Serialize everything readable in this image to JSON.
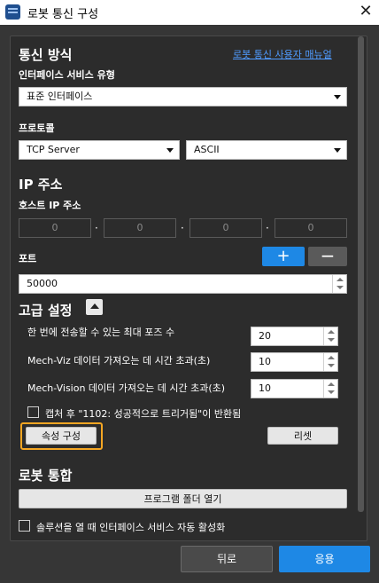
{
  "window": {
    "title": "로봇 통신 구성",
    "close_glyph": "✕"
  },
  "communication": {
    "heading": "통신 방식",
    "manual_link": "로봇 통신 사용자 매뉴얼",
    "interface_type_label": "인터페이스 서비스 유형",
    "interface_type_value": "표준 인터페이스",
    "protocol_label": "프로토콜",
    "protocol_transport": "TCP Server",
    "protocol_format": "ASCII"
  },
  "ip": {
    "heading": "IP 주소",
    "host_label": "호스트 IP 주소",
    "octets": [
      "0",
      "0",
      "0",
      "0"
    ],
    "port_label": "포트",
    "port_value": "50000",
    "add_glyph": "+",
    "remove_glyph": "−"
  },
  "advanced": {
    "heading": "고급 설정",
    "max_poses_label": "한 번에 전송할 수 있는 최대 포즈 수",
    "max_poses_value": "20",
    "viz_timeout_label": "Mech-Viz 데이터 가져오는 데 시간 초과(초)",
    "viz_timeout_value": "10",
    "vision_timeout_label": "Mech-Vision 데이터 가져오는 데 시간 초과(초)",
    "vision_timeout_value": "10",
    "capture_check_label": "캡처 후 \"1102: 성공적으로 트리거됨\"이 반환됨",
    "configure_button": "속성 구성",
    "reset_button": "리셋"
  },
  "robot_integration": {
    "heading": "로봇 통합",
    "open_folder_button": "프로그램 폴더 열기",
    "auto_enable_label": "솔루션을 열 때 인터페이스 서비스 자동 활성화"
  },
  "footer": {
    "back_button": "뒤로",
    "apply_button": "응용"
  },
  "colors": {
    "accent": "#1e88e5",
    "highlight": "#f5a623",
    "link": "#4f9bff",
    "panel": "#2c2c2c"
  }
}
